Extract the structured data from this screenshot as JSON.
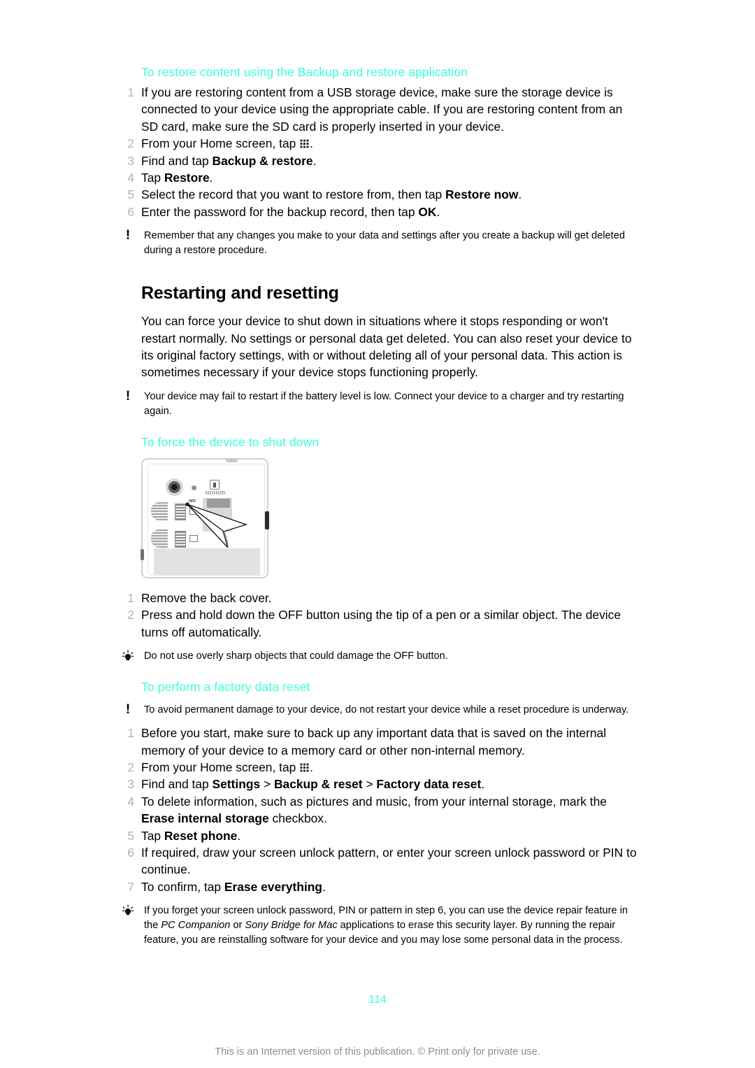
{
  "document": {
    "page_number": "114",
    "footer_text": "This is an Internet version of this publication. © Print only for private use.",
    "accent_color": "#3dfdd8",
    "step_number_color": "#b3b3b3"
  },
  "section_restore": {
    "heading": "To restore content using the Backup and restore application",
    "steps": [
      {
        "num": "1",
        "text": "If you are restoring content from a USB storage device, make sure the storage device is connected to your device using the appropriate cable. If you are restoring content from an SD card, make sure the SD card is properly inserted in your device."
      },
      {
        "num": "2",
        "pre": "From your Home screen, tap ",
        "icon": "app-drawer-icon",
        "post": "."
      },
      {
        "num": "3",
        "pre": "Find and tap ",
        "bold": "Backup & restore",
        "post": "."
      },
      {
        "num": "4",
        "pre": "Tap ",
        "bold": "Restore",
        "post": "."
      },
      {
        "num": "5",
        "pre": "Select the record that you want to restore from, then tap ",
        "bold": "Restore now",
        "post": "."
      },
      {
        "num": "6",
        "pre": "Enter the password for the backup record, then tap ",
        "bold": "OK",
        "post": "."
      }
    ],
    "note": {
      "icon": "warning-exclamation-icon",
      "text": "Remember that any changes you make to your data and settings after you create a backup will get deleted during a restore procedure."
    }
  },
  "section_restarting": {
    "heading": "Restarting and resetting",
    "paragraph": "You can force your device to shut down in situations where it stops responding or won't restart normally. No settings or personal data get deleted. You can also reset your device to its original factory settings, with or without deleting all of your personal data. This action is sometimes necessary if your device stops functioning properly.",
    "note": {
      "icon": "warning-exclamation-icon",
      "text": "Your device may fail to restart if the battery level is low. Connect your device to a charger and try restarting again."
    }
  },
  "section_shutdown": {
    "heading": "To force the device to shut down",
    "figure": {
      "name": "device-back-cover-off-button-illustration",
      "off_label": "OFF"
    },
    "steps": [
      {
        "num": "1",
        "text": "Remove the back cover."
      },
      {
        "num": "2",
        "text": "Press and hold down the OFF button using the tip of a pen or a similar object. The device turns off automatically."
      }
    ],
    "tip": {
      "icon": "tip-lightbulb-icon",
      "text": "Do not use overly sharp objects that could damage the OFF button."
    }
  },
  "section_factory_reset": {
    "heading": "To perform a factory data reset",
    "note": {
      "icon": "warning-exclamation-icon",
      "text": "To avoid permanent damage to your device, do not restart your device while a reset procedure is underway."
    },
    "steps": [
      {
        "num": "1",
        "text": "Before you start, make sure to back up any important data that is saved on the internal memory of your device to a memory card or other non-internal memory."
      },
      {
        "num": "2",
        "pre": "From your Home screen, tap ",
        "icon": "app-drawer-icon",
        "post": "."
      },
      {
        "num": "3",
        "pre": "Find and tap ",
        "bold1": "Settings",
        "sep1": " > ",
        "bold2": "Backup & reset",
        "sep2": " > ",
        "bold3": "Factory data reset",
        "post": "."
      },
      {
        "num": "4",
        "pre": "To delete information, such as pictures and music, from your internal storage, mark the ",
        "bold": "Erase internal storage",
        "post": " checkbox."
      },
      {
        "num": "5",
        "pre": "Tap ",
        "bold": "Reset phone",
        "post": "."
      },
      {
        "num": "6",
        "text": "If required, draw your screen unlock pattern, or enter your screen unlock password or PIN to continue."
      },
      {
        "num": "7",
        "pre": "To confirm, tap ",
        "bold": "Erase everything",
        "post": "."
      }
    ],
    "tip": {
      "icon": "tip-lightbulb-icon",
      "part1": "If you forget your screen unlock password, PIN or pattern in step 6, you can use the device repair feature in the ",
      "italic1": "PC Companion",
      "part2": " or ",
      "italic2": "Sony Bridge for Mac",
      "part3": " applications to erase this security layer. By running the repair feature, you are reinstalling software for your device and you may lose some personal data in the process."
    }
  }
}
